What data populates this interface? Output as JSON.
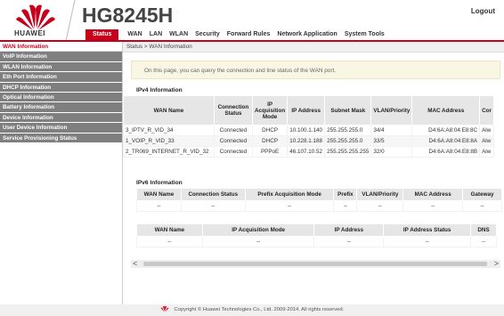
{
  "header": {
    "brand": "HUAWEI",
    "model": "HG8245H",
    "logout": "Logout"
  },
  "nav": [
    "Status",
    "WAN",
    "LAN",
    "WLAN",
    "Security",
    "Forward Rules",
    "Network Application",
    "System Tools"
  ],
  "sidebar": [
    "WAN Information",
    "VoIP Information",
    "WLAN Information",
    "Eth Port Information",
    "DHCP Information",
    "Optical Information",
    "Battery Information",
    "Device Information",
    "User Device Information",
    "Service Provisioning Status"
  ],
  "breadcrumb": "Status > WAN Information",
  "notice": "On this page, you can query the connection and line status of the WAN port.",
  "ipv4": {
    "title": "IPv4 Information",
    "headers": [
      "WAN Name",
      "Connection Status",
      "IP Acquisition Mode",
      "IP Address",
      "Subnet Mask",
      "VLAN/Priority",
      "MAC Address",
      "Cor"
    ],
    "rows": [
      [
        "3_IPTV_R_VID_34",
        "Connected",
        "DHCP",
        "10.100.1.140",
        "255.255.255.0",
        "34/4",
        "D4:6A:A8:04:E8:8C",
        "Alw"
      ],
      [
        "1_VOIP_R_VID_33",
        "Connected",
        "DHCP",
        "10.228.1.188",
        "255.255.255.0",
        "33/5",
        "D4:6A:A8:04:E8:8A",
        "Alw"
      ],
      [
        "2_TR069_INTERNET_R_VID_32",
        "Connected",
        "PPPoE",
        "46.107.10.52",
        "255.255.255.255",
        "32/0",
        "D4:6A:A8:04:E8:8B",
        "Alw"
      ]
    ]
  },
  "ipv6": {
    "title": "IPv6 Information",
    "headers": [
      "WAN Name",
      "Connection Status",
      "Prefix Acquisition Mode",
      "Prefix",
      "VLAN/Priority",
      "MAC Address",
      "Gateway"
    ],
    "row": [
      "--",
      "--",
      "--",
      "--",
      "--",
      "--",
      "--"
    ],
    "headers2": [
      "WAN Name",
      "IP Acquisition Mode",
      "IP Address",
      "IP Address Status",
      "DNS"
    ],
    "row2": [
      "--",
      "--",
      "--",
      "--",
      "--"
    ]
  },
  "scroll": {
    "left": "<",
    "right": ">"
  },
  "footer": "Copyright © Huawei Technologies Co., Ltd. 2009-2014. All rights reserved.",
  "colors": {
    "brand_red": "#c6001b",
    "sidebar_gray": "#7f7f7f"
  }
}
